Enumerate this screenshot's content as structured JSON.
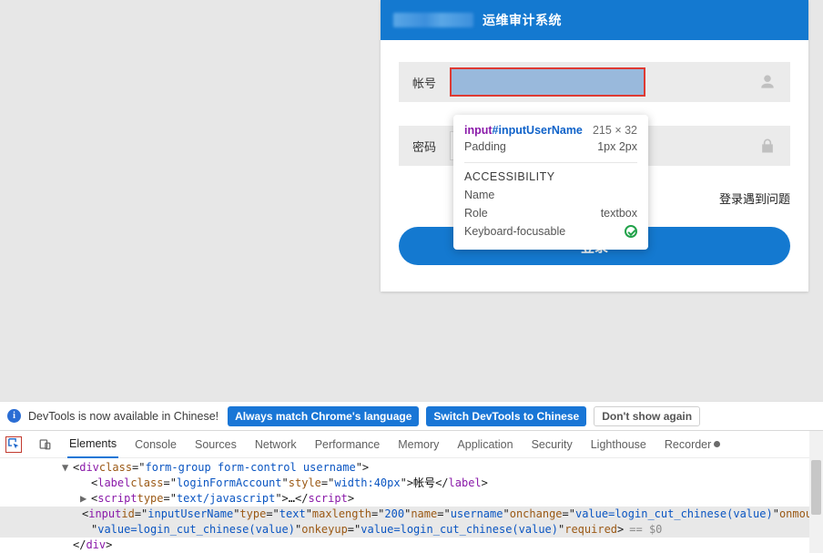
{
  "login": {
    "title": "运维审计系统",
    "username_label": "帐号",
    "password_label": "密码",
    "trouble_link": "登录遇到问题",
    "login_button": "登录"
  },
  "inspector_tip": {
    "selector_tag": "input",
    "selector_id": "#inputUserName",
    "dimensions": "215 × 32",
    "padding_label": "Padding",
    "padding_value": "1px 2px",
    "a11y_header": "ACCESSIBILITY",
    "name_label": "Name",
    "name_value": "",
    "role_label": "Role",
    "role_value": "textbox",
    "keyfoc_label": "Keyboard-focusable"
  },
  "info_bar": {
    "message": "DevTools is now available in Chinese!",
    "btn_match": "Always match Chrome's language",
    "btn_switch": "Switch DevTools to Chinese",
    "btn_dont": "Don't show again"
  },
  "devtools": {
    "tabs": {
      "elements": "Elements",
      "console": "Console",
      "sources": "Sources",
      "network": "Network",
      "performance": "Performance",
      "memory": "Memory",
      "application": "Application",
      "security": "Security",
      "lighthouse": "Lighthouse",
      "recorder": "Recorder"
    },
    "code": {
      "l1_class": "form-group form-control username",
      "l2_class": "loginFormAccount",
      "l2_style": "width:40px",
      "l2_text": "帐号",
      "l3_type": "text/javascript",
      "l4_id": "inputUserName",
      "l4_type": "text",
      "l4_maxlength": "200",
      "l4_name": "username",
      "l4_onchange": "value=login_cut_chinese(value)",
      "l4_onmouseup_frag": "onmouseup=",
      "l5_value": "value=login_cut_chinese(value)",
      "l5_onkeyup": "value=login_cut_chinese(value)",
      "eq_token": "== $0"
    }
  }
}
